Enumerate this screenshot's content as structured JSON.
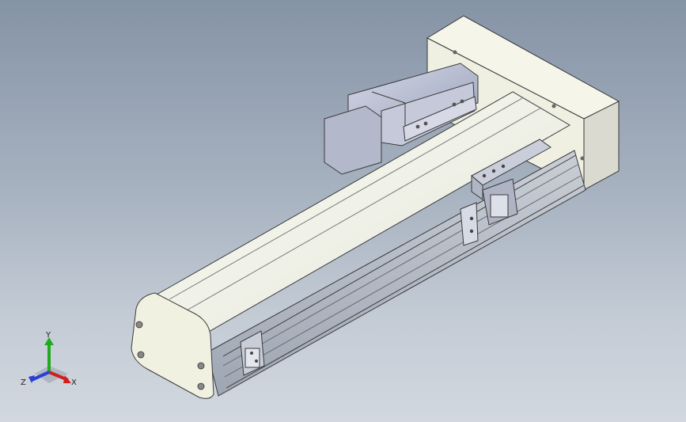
{
  "viewport": {
    "background_top": "#8593a6",
    "background_bottom": "#d2d8df"
  },
  "model": {
    "body_color": "#f3f3e4",
    "rail_color": "#d9dde3",
    "steel_color": "#aeb4c4",
    "edge_color": "#3a3a3a"
  },
  "triad": {
    "x_label": "X",
    "y_label": "Y",
    "z_label": "Z",
    "x_color": "#d21e1e",
    "y_color": "#1faa1f",
    "z_color": "#2a3fd6"
  }
}
